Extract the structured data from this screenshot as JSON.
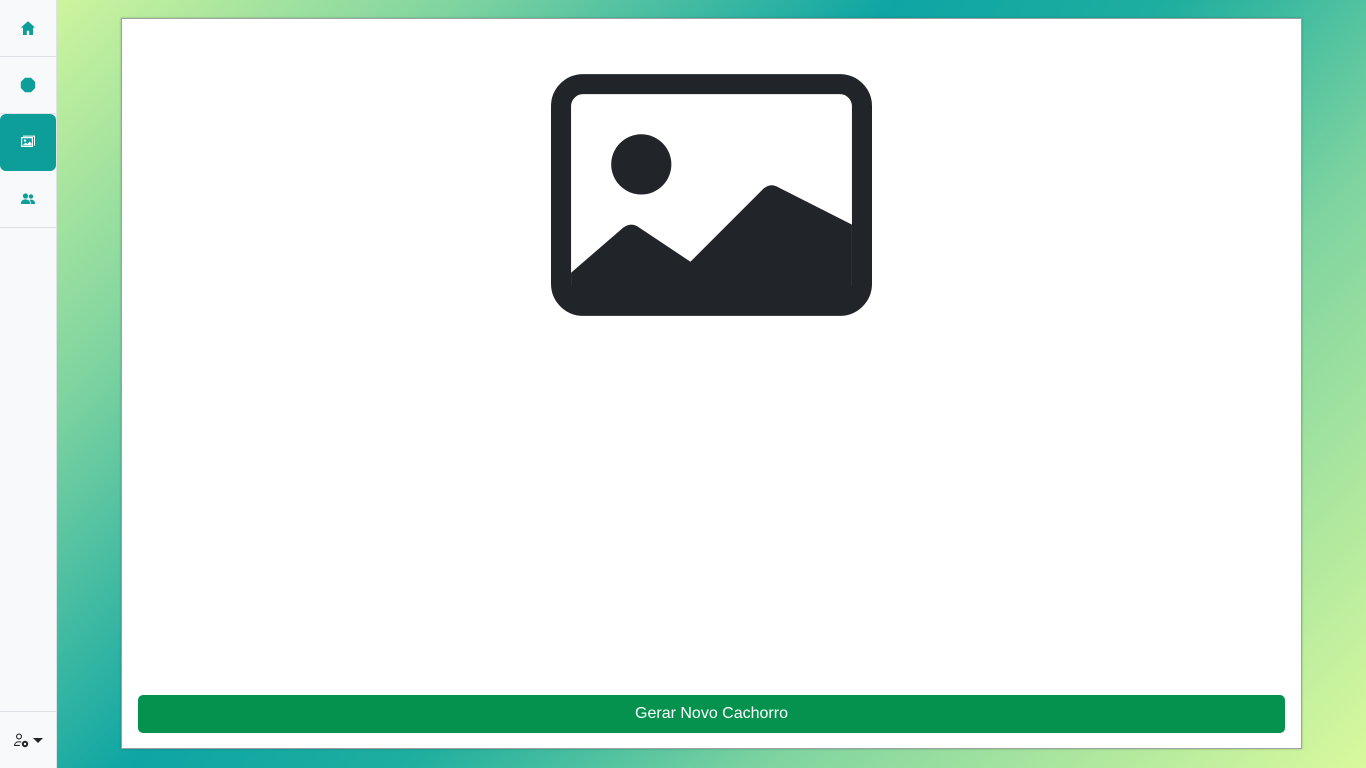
{
  "sidebar": {
    "items": [
      {
        "icon": "home-icon",
        "active": false
      },
      {
        "icon": "octagon-icon",
        "active": false
      },
      {
        "icon": "images-icon",
        "active": true
      },
      {
        "icon": "people-icon",
        "active": false
      }
    ],
    "user_menu": {
      "icon": "person-gear-icon",
      "caret": "caret-down-icon"
    }
  },
  "main": {
    "image": {
      "icon": "image-placeholder-icon"
    },
    "generate_button_label": "Gerar Novo Cachorro"
  },
  "colors": {
    "accent": "#0d9e9a",
    "button": "#05924f",
    "sidebar_bg": "#f8f9fa",
    "icon_dark": "#212529"
  }
}
